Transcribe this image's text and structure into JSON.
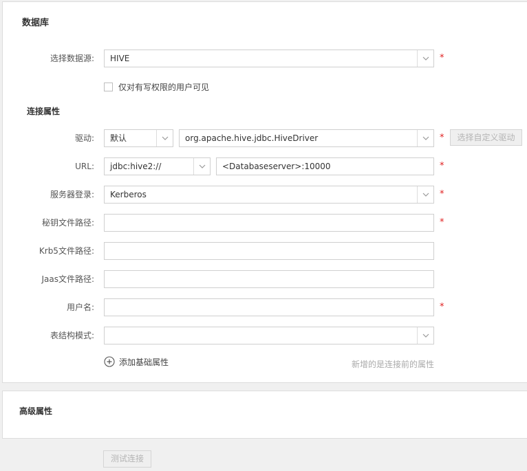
{
  "database_section": {
    "title": "数据库",
    "datasource": {
      "label": "选择数据源:",
      "value": "HIVE"
    },
    "write_only_checkbox": {
      "label": "仅对有写权限的用户可见",
      "checked": false
    },
    "connection_props_title": "连接属性",
    "driver": {
      "label": "驱动:",
      "type_value": "默认",
      "class_value": "org.apache.hive.jdbc.HiveDriver",
      "custom_button": "选择自定义驱动"
    },
    "url": {
      "label": "URL:",
      "prefix_value": "jdbc:hive2://",
      "host_value": "<Databaseserver>:10000"
    },
    "server_login": {
      "label": "服务器登录:",
      "value": "Kerberos"
    },
    "keytab_path": {
      "label": "秘钥文件路径:",
      "value": ""
    },
    "krb5_path": {
      "label": "Krb5文件路径:",
      "value": ""
    },
    "jaas_path": {
      "label": "Jaas文件路径:",
      "value": ""
    },
    "username": {
      "label": "用户名:",
      "value": ""
    },
    "schema": {
      "label": "表结构模式:",
      "value": ""
    },
    "add_basic_property": "添加基础属性",
    "hint": "新增的是连接前的属性",
    "required_mark": "*"
  },
  "advanced_section": {
    "title": "高级属性"
  },
  "test_connection_button": "测试连接",
  "colors": {
    "required": "#e02020",
    "border": "#cfcfcf",
    "disabled_text": "#b4b4b4",
    "hint_text": "#aaaaaa"
  }
}
